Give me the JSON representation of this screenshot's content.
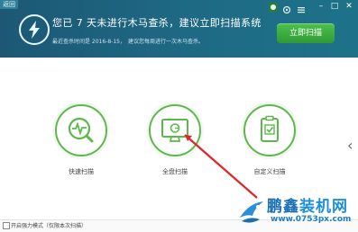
{
  "header": {
    "back_label": "返回",
    "headline": "您已 7 天未进行木马查杀，建议立即扫描系统",
    "last_scan_label": "最近查杀时间是 2016-8-15，",
    "advice": "建议您每周进行一次木马查杀。",
    "scan_button": "立即扫描",
    "bg_color": "#1e6a85",
    "button_color": "#3aa73c"
  },
  "scan_options": [
    {
      "label": "快速扫描",
      "icon": "heartbeat-magnifier-icon"
    },
    {
      "label": "全盘扫描",
      "icon": "monitor-scan-icon"
    },
    {
      "label": "自定义扫描",
      "icon": "clipboard-check-icon"
    }
  ],
  "footer": {
    "checkbox_label": "开启强力模式（仅限本次扫描）"
  },
  "watermark": {
    "title_a": "鹏鑫",
    "title_b": "装机网",
    "url": "www.0753px.com"
  },
  "accent_green": "#5cb84a",
  "arrow_color": "#e0242a"
}
